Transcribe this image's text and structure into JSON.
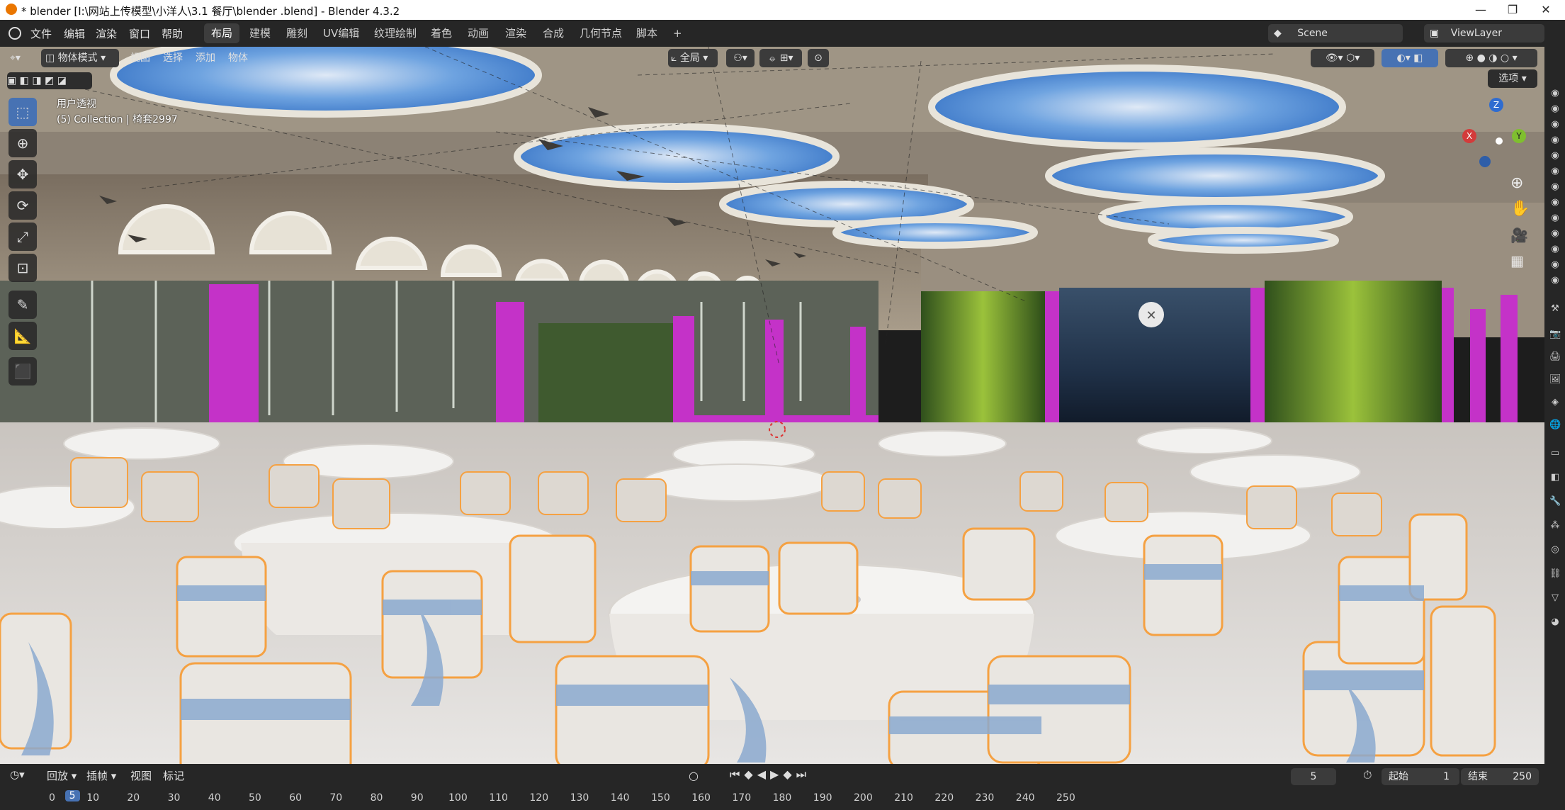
{
  "window": {
    "title": "* blender  [I:\\网站上传模型\\小洋人\\3.1 餐厅\\blender .blend] - Blender 4.3.2",
    "minimize": "—",
    "maximize": "❐",
    "close": "✕"
  },
  "menu": {
    "items": [
      "文件",
      "编辑",
      "渲染",
      "窗口",
      "帮助"
    ],
    "workspaces": [
      "布局",
      "建模",
      "雕刻",
      "UV编辑",
      "纹理绘制",
      "着色",
      "动画",
      "渲染",
      "合成",
      "几何节点",
      "脚本"
    ],
    "active_workspace": "布局",
    "add_tab": "+",
    "scene": "Scene",
    "view_layer": "ViewLayer"
  },
  "viewport_header": {
    "mode": "物体模式",
    "items": [
      "视图",
      "选择",
      "添加",
      "物体"
    ],
    "transform_orientation": "全局",
    "options": "选项"
  },
  "viewport_overlay": {
    "view_name": "用户透视",
    "collection_info": "(5) Collection | 椅套2997"
  },
  "gizmo": {
    "x": "X",
    "y": "Y",
    "z": "Z"
  },
  "timeline": {
    "playback": "回放",
    "keying": "插帧",
    "view": "视图",
    "marker": "标记",
    "current_frame": "5",
    "start_label": "起始",
    "start_value": "1",
    "end_label": "结束",
    "end_value": "250",
    "ticks": [
      "0",
      "5",
      "10",
      "20",
      "30",
      "40",
      "50",
      "60",
      "70",
      "80",
      "90",
      "100",
      "110",
      "120",
      "130",
      "140",
      "150",
      "160",
      "170",
      "180",
      "190",
      "200",
      "210",
      "220",
      "230",
      "240",
      "250"
    ]
  },
  "colors": {
    "accent": "#4772b3",
    "selection_outline": "#f5a142",
    "magenta_pillar": "#c432c8",
    "sky": "#4f8fd6"
  },
  "tools": [
    "select-box-icon",
    "cursor-icon",
    "move-icon",
    "rotate-icon",
    "scale-icon",
    "transform-icon",
    "annotate-icon",
    "measure-icon",
    "add-cube-icon"
  ]
}
